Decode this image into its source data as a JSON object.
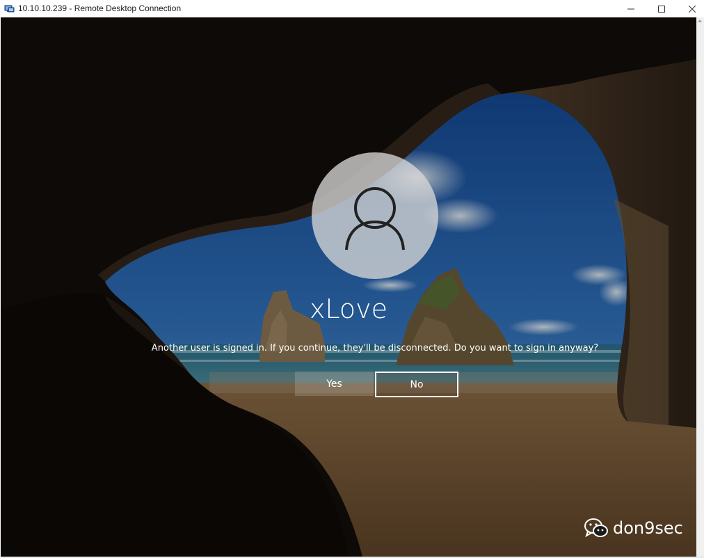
{
  "window": {
    "title": "10.10.10.239 - Remote Desktop Connection",
    "icon": "remote-desktop-icon",
    "controls": [
      "minimize-icon",
      "maximize-icon",
      "close-icon"
    ]
  },
  "lock_screen": {
    "avatar_icon": "user-icon",
    "username": "xLove",
    "message": "Another user is signed in. If you continue, they'll be disconnected. Do you want to sign in anyway?",
    "yes_label": "Yes",
    "no_label": "No"
  },
  "watermark": {
    "icon": "wechat-icon",
    "text": "don9sec"
  },
  "colors": {
    "text": "#ffffff",
    "avatar_bg": "#d6d6d6",
    "titlebar_bg": "#ffffff"
  }
}
